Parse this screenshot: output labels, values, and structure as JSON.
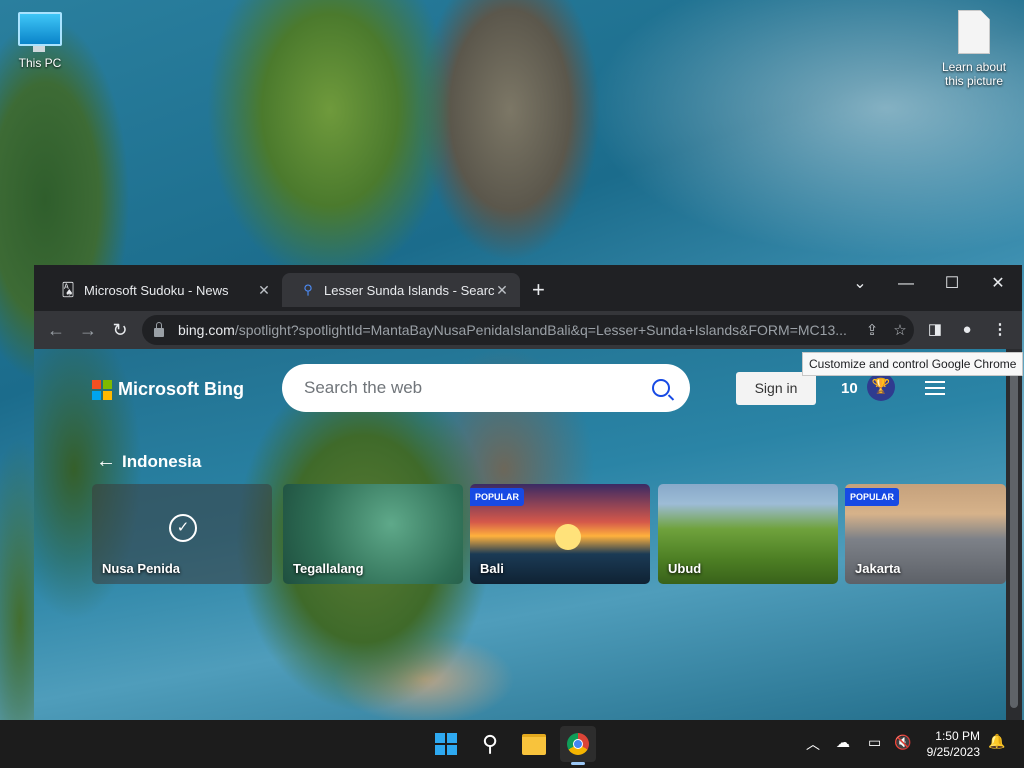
{
  "desktop": {
    "icons": [
      {
        "label": "This PC"
      },
      {
        "label": "Learn about this picture"
      }
    ]
  },
  "browser": {
    "tabs": [
      {
        "title": "Microsoft Sudoku - News",
        "active": false
      },
      {
        "title": "Lesser Sunda Islands - Search",
        "active": true
      }
    ],
    "new_tab": "+",
    "url_host": "bing.com",
    "url_path": "/spotlight?spotlightId=MantaBayNusaPenidaIslandBali&q=Lesser+Sunda+Islands&FORM=MC13...",
    "tooltip": "Customize and control Google Chrome"
  },
  "bing": {
    "logo_text": "Microsoft Bing",
    "search_placeholder": "Search the web",
    "signin_label": "Sign in",
    "reward_points": "10",
    "section_title": "Indonesia",
    "cards": [
      {
        "label": "Nusa Penida",
        "badge": "",
        "selected": true
      },
      {
        "label": "Tegallalang",
        "badge": "",
        "selected": false
      },
      {
        "label": "Bali",
        "badge": "POPULAR",
        "selected": false
      },
      {
        "label": "Ubud",
        "badge": "",
        "selected": false
      },
      {
        "label": "Jakarta",
        "badge": "POPULAR",
        "selected": false
      }
    ],
    "colors": {
      "accent": "#174ae4",
      "ms_red": "#f25022",
      "ms_green": "#7fba00",
      "ms_blue": "#00a4ef",
      "ms_yellow": "#ffb900"
    }
  },
  "taskbar": {
    "time": "1:50 PM",
    "date": "9/25/2023"
  }
}
